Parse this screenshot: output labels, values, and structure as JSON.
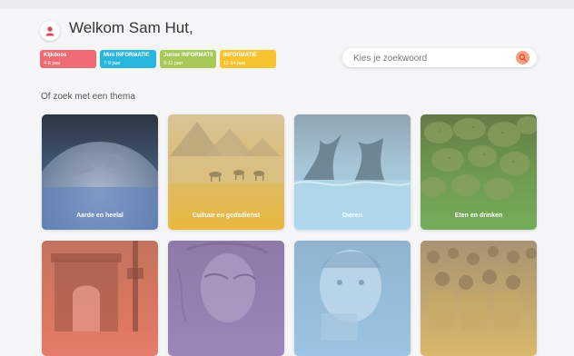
{
  "header": {
    "greeting": "Welkom Sam Hut,"
  },
  "age_groups": [
    {
      "name": "Kijkdoos",
      "ages": "4-6 jaar",
      "color": "#ee6b73"
    },
    {
      "name": "Mini INFORMATIE",
      "ages": "7-9 jaar",
      "color": "#27b6dc"
    },
    {
      "name": "Junior INFORMATIE",
      "ages": "9-11 jaar",
      "color": "#a7c957"
    },
    {
      "name": "INFORMATIE",
      "ages": "11-14 jaar",
      "color": "#f7c430"
    }
  ],
  "search": {
    "placeholder": "Kies je zoekwoord",
    "icon": "search-icon"
  },
  "themes": {
    "heading": "Of zoek met een thema",
    "cards": [
      {
        "label": "Aarde en heelal",
        "color": "#5b7fbe"
      },
      {
        "label": "Cultuur en godsdienst",
        "color": "#e8b83e"
      },
      {
        "label": "Dieren",
        "color": "#9fd4ee"
      },
      {
        "label": "Eten en drinken",
        "color": "#74ad5a"
      },
      {
        "label": "",
        "color": "#e67b6b"
      },
      {
        "label": "",
        "color": "#9a86b8"
      },
      {
        "label": "",
        "color": "#9bc4e2"
      },
      {
        "label": "",
        "color": "#d9b86a"
      }
    ]
  }
}
